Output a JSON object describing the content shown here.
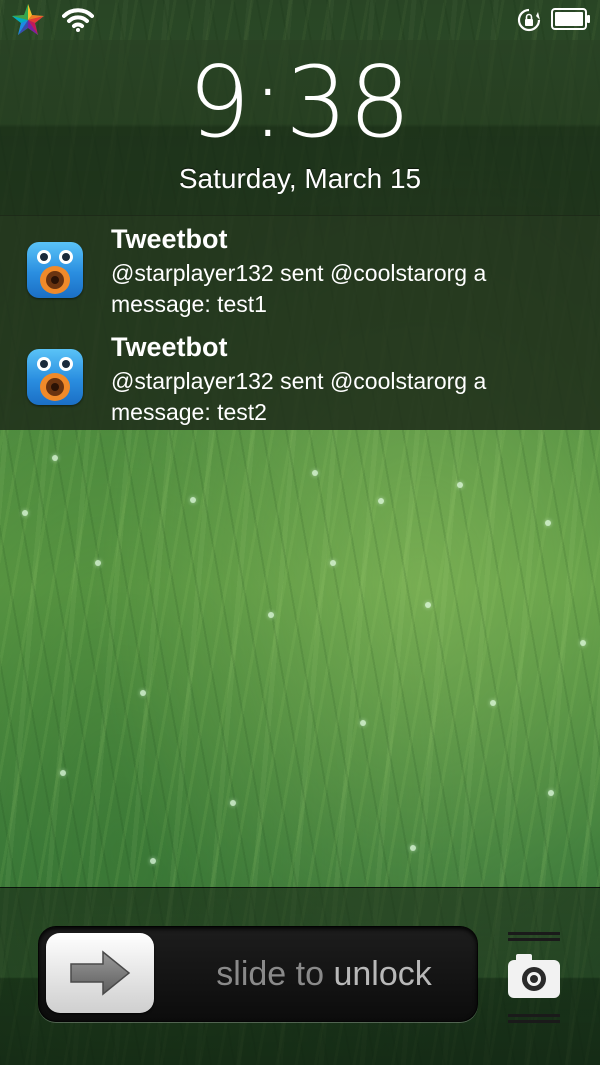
{
  "status_bar": {
    "icons": [
      "cydia-star-icon",
      "wifi-icon",
      "rotation-lock-icon",
      "battery-icon"
    ]
  },
  "lock_screen": {
    "time": "9:38",
    "date": "Saturday, March 15"
  },
  "notifications": [
    {
      "app": "Tweetbot",
      "icon": "tweetbot-icon",
      "line1": "@starplayer132 sent @coolstarorg a",
      "line2": "message: test1"
    },
    {
      "app": "Tweetbot",
      "icon": "tweetbot-icon",
      "line1": "@starplayer132 sent @coolstarorg a",
      "line2": "message: test2"
    }
  ],
  "unlock": {
    "label_pre": "slide to ",
    "label_highlight": "unlock",
    "camera_icon": "camera-icon"
  },
  "colors": {
    "tweetbot_blue": "#2a8ee0",
    "tweetbot_orange": "#f08a2a",
    "clock_text": "#ffffff",
    "slider_text": "#8a8a8a"
  }
}
